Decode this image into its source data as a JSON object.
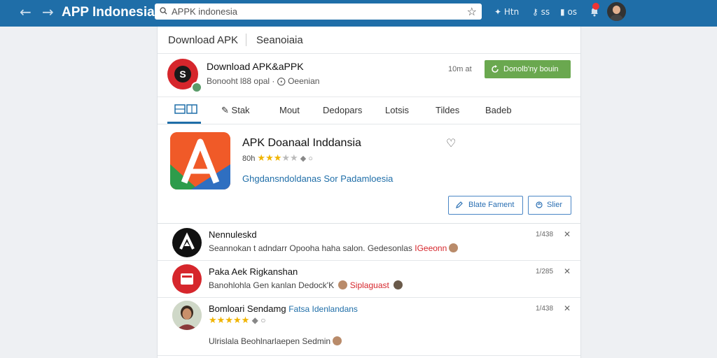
{
  "topbar": {
    "title": "APP Indonesia",
    "search_value": "APPK indonesia",
    "items": [
      {
        "icon": "puzzle-icon",
        "label": "Htn"
      },
      {
        "icon": "key-icon",
        "label": "ss"
      },
      {
        "icon": "book-icon",
        "label": "os"
      }
    ]
  },
  "header": {
    "title": "Download APK",
    "subtitle": "Seanoiaia"
  },
  "publisher": {
    "logo_letter": "S",
    "title": "Download APK&aPPK",
    "subtitle": "Bonooht l88 opal · ⨀ Oeenian",
    "time": "10m at",
    "download_label": "Donolb'ny bouin"
  },
  "tabs": [
    {
      "label": "Stak",
      "icon": "pencil-icon"
    },
    {
      "label": "Mout"
    },
    {
      "label": "Dedopars"
    },
    {
      "label": "Lotsis"
    },
    {
      "label": "Tildes"
    },
    {
      "label": "Badeb"
    }
  ],
  "featured": {
    "title": "APK Doanaal Inddansia",
    "rating_label": "80h",
    "rating": 3,
    "rating_max": 5,
    "link": "Ghgdansndoldanas Sor Padamloesia",
    "button1": "Blate Fament",
    "button2": "Slier"
  },
  "list": [
    {
      "title": "Nennuleskd",
      "text": "Seannokan t adndarr Opooha haha salon. Gedesonlas",
      "highlight": "IGeeonn",
      "time": "1/438"
    },
    {
      "title": "Paka Aek Rigkanshan",
      "text": "Banohlohla Gen kanlan Dedock'K",
      "highlight": "Siplaguast",
      "time": "1/285"
    },
    {
      "title": "Bomloari Sendamg",
      "title_link": "Fatsa Idenlandans",
      "text": "Ulrislala Beohlnarlaepen Sedmin",
      "rating": 5,
      "time": "1/438"
    }
  ],
  "colors": {
    "topbar": "#1f6ea8",
    "accent_green": "#6aa84f",
    "link_blue": "#1f6ea8",
    "star": "#f0b400",
    "highlight_red": "#d6262c"
  }
}
